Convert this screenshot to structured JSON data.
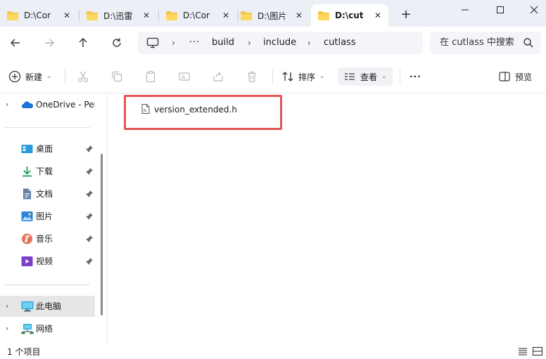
{
  "window": {
    "tabs": [
      {
        "label": "D:\\Cor",
        "active": false
      },
      {
        "label": "D:\\迅雷",
        "active": false
      },
      {
        "label": "D:\\Cor",
        "active": false
      },
      {
        "label": "D:\\图片",
        "active": false
      },
      {
        "label": "D:\\cut",
        "active": true
      }
    ],
    "new_tab_label": "+",
    "minimize_label": "—",
    "maximize_label": "☐",
    "close_label": "✕"
  },
  "address": {
    "more": "···",
    "path": [
      "build",
      "include",
      "cutlass"
    ],
    "search_placeholder": "在 cutlass 中搜索"
  },
  "toolbar": {
    "new_label": "新建",
    "sort_label": "排序",
    "view_label": "查看",
    "more_label": "···",
    "preview_label": "预览"
  },
  "sidebar": {
    "onedrive_label": "OneDrive - Personal",
    "quick_access": [
      {
        "label": "桌面",
        "icon": "desktop-icon"
      },
      {
        "label": "下载",
        "icon": "download-icon"
      },
      {
        "label": "文档",
        "icon": "document-icon"
      },
      {
        "label": "图片",
        "icon": "pictures-icon"
      },
      {
        "label": "音乐",
        "icon": "music-icon"
      },
      {
        "label": "视频",
        "icon": "videos-icon"
      }
    ],
    "this_pc_label": "此电脑",
    "network_label": "网络"
  },
  "files": [
    {
      "name": "version_extended.h",
      "type": "header-file"
    }
  ],
  "status": {
    "item_count": "1 个项目"
  },
  "colors": {
    "tab_strip_bg": "#ecf0f6",
    "highlight_border": "#e25756",
    "folder_yellow": "#f5c243",
    "selection_bg": "#e6e6e6"
  }
}
